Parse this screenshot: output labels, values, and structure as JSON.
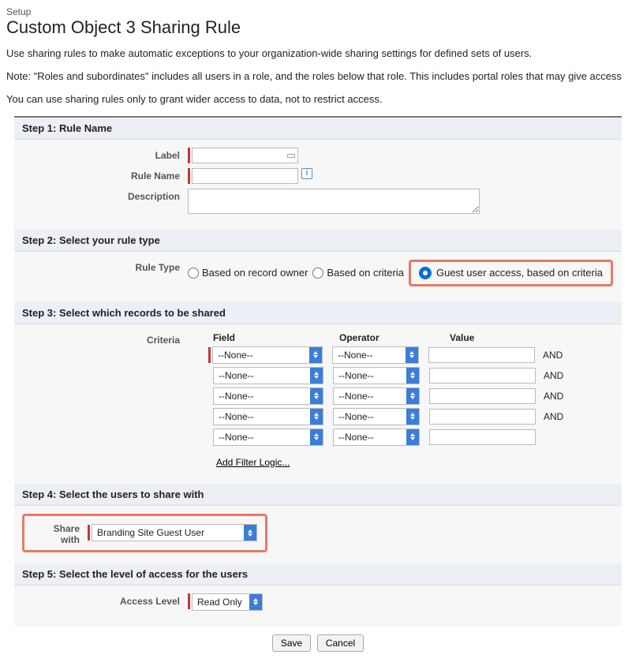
{
  "breadcrumb": "Setup",
  "page_title": "Custom Object 3 Sharing Rule",
  "intro": {
    "p1": "Use sharing rules to make automatic exceptions to your organization-wide sharing settings for defined sets of users.",
    "p2": "Note: \"Roles and subordinates\" includes all users in a role, and the roles below that role. This includes portal roles that may give access",
    "p3": "You can use sharing rules only to grant wider access to data, not to restrict access."
  },
  "steps": {
    "s1": {
      "title": "Step 1: Rule Name",
      "label": "Label",
      "rule_name": "Rule Name",
      "description": "Description",
      "label_val": "",
      "rule_name_val": "",
      "description_val": ""
    },
    "s2": {
      "title": "Step 2: Select your rule type",
      "rule_type_label": "Rule Type",
      "opt1": "Based on record owner",
      "opt2": "Based on criteria",
      "opt3": "Guest user access, based on criteria"
    },
    "s3": {
      "title": "Step 3: Select which records to be shared",
      "criteria_label": "Criteria",
      "col_field": "Field",
      "col_operator": "Operator",
      "col_value": "Value",
      "none": "--None--",
      "and": "AND",
      "add_filter": "Add Filter Logic..."
    },
    "s4": {
      "title": "Step 4: Select the users to share with",
      "share_with_label": "Share with",
      "share_with_value": "Branding Site Guest User"
    },
    "s5": {
      "title": "Step 5: Select the level of access for the users",
      "access_label": "Access Level",
      "access_value": "Read Only"
    }
  },
  "buttons": {
    "save": "Save",
    "cancel": "Cancel"
  }
}
